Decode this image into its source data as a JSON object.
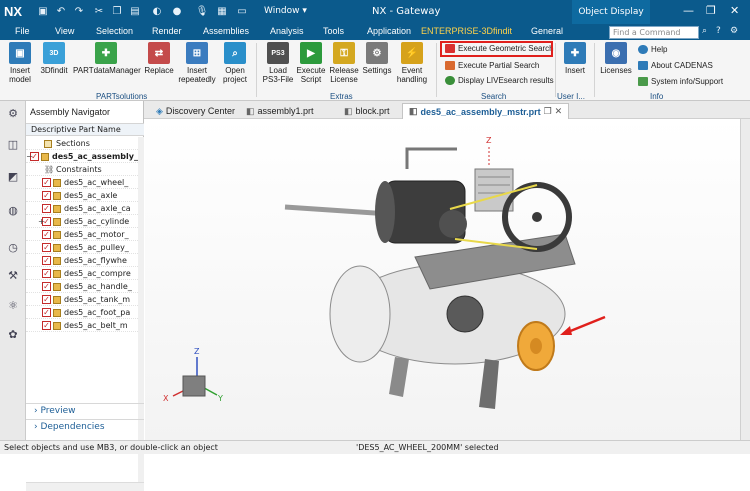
{
  "app": {
    "logo": "NX",
    "title": "NX - Gateway",
    "window_menu": "Window",
    "context_tab": "Object Display"
  },
  "menubar": {
    "tabs": [
      "File",
      "View",
      "Selection",
      "Render",
      "Assemblies",
      "Analysis",
      "Tools",
      "Application",
      "ENTERPRISE-3Dfindit",
      "General"
    ],
    "active_tab": "ENTERPRISE-3Dfindit",
    "search_placeholder": "Find a Command"
  },
  "ribbon": {
    "buttons": [
      {
        "label1": "Insert",
        "label2": "model",
        "icon": "insert-model-icon",
        "color": "#2e7bb8"
      },
      {
        "label1": "3Dfindit",
        "label2": "",
        "icon": "3dfindit-icon",
        "color": "#3aa0d8"
      },
      {
        "label1": "PARTdataManager",
        "label2": "",
        "icon": "partdatamanager-icon",
        "color": "#3aa34a"
      },
      {
        "label1": "Replace",
        "label2": "",
        "icon": "replace-icon",
        "color": "#c44a4a"
      },
      {
        "label1": "Insert",
        "label2": "repeatedly",
        "icon": "insert-repeatedly-icon",
        "color": "#3b7cbf"
      },
      {
        "label1": "Open",
        "label2": "project",
        "icon": "open-project-icon",
        "color": "#2a8fca"
      },
      {
        "label1": "Load",
        "label2": "PS3-File",
        "icon": "load-ps3-icon",
        "color": "#505050"
      },
      {
        "label1": "Execute",
        "label2": "Script",
        "icon": "execute-script-icon",
        "color": "#2c9a3c"
      },
      {
        "label1": "Release",
        "label2": "License",
        "icon": "release-license-icon",
        "color": "#d4a820"
      },
      {
        "label1": "Settings",
        "label2": "",
        "icon": "settings-icon",
        "color": "#7a7a7a"
      },
      {
        "label1": "Event",
        "label2": "handling",
        "icon": "event-handling-icon",
        "color": "#d6a21b"
      }
    ],
    "groups": {
      "partsolutions": "PARTsolutions",
      "extras": "Extras",
      "search": "Search",
      "user": "User I...",
      "info": "Info"
    },
    "search_items": [
      "Execute Geometric Search",
      "Execute Partial Search",
      "Display LIVEsearch results"
    ],
    "user_button": "Insert",
    "licenses": "Licenses",
    "info_items": [
      "Help",
      "About CADENAS",
      "System info/Support"
    ]
  },
  "doc_tabs": [
    "Discovery Center",
    "assembly1.prt",
    "block.prt",
    "des5_ac_assembly_mstr.prt"
  ],
  "navigator": {
    "title": "Assembly Navigator",
    "column": "Descriptive Part Name",
    "rows": [
      {
        "label": "Sections",
        "level": 1
      },
      {
        "label": "des5_ac_assembly_",
        "level": 0
      },
      {
        "label": "Constraints",
        "level": 1
      },
      {
        "label": "des5_ac_wheel_",
        "level": 1
      },
      {
        "label": "des5_ac_axle",
        "level": 1
      },
      {
        "label": "des5_ac_axle_ca",
        "level": 1
      },
      {
        "label": "des5_ac_cylinde",
        "level": 1
      },
      {
        "label": "des5_ac_motor_",
        "level": 1
      },
      {
        "label": "des5_ac_pulley_",
        "level": 1
      },
      {
        "label": "des5_ac_flywhe",
        "level": 1
      },
      {
        "label": "des5_ac_compre",
        "level": 1
      },
      {
        "label": "des5_ac_handle_",
        "level": 1
      },
      {
        "label": "des5_ac_tank_m",
        "level": 1
      },
      {
        "label": "des5_ac_foot_pa",
        "level": 1
      },
      {
        "label": "des5_ac_belt_m",
        "level": 1
      }
    ],
    "panes": [
      "Preview",
      "Dependencies"
    ]
  },
  "status": {
    "left": "Select objects and use MB3, or double-click an object",
    "center": "'DES5_AC_WHEEL_200MM' selected"
  },
  "triad": {
    "z": "Z",
    "x": "X",
    "y": "Y"
  },
  "colors": {
    "accent": "#0b5a8c",
    "highlight": "#e0201c",
    "selection": "#f0a93a"
  }
}
